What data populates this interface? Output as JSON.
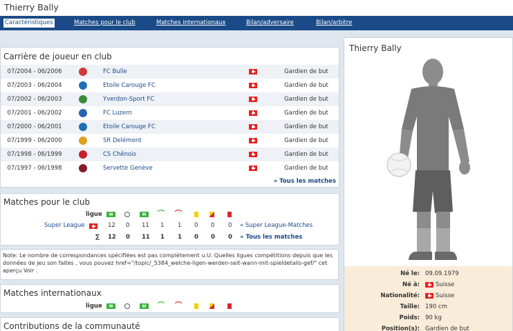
{
  "page": {
    "title": "Thierry Bally"
  },
  "nav": [
    {
      "label": "Caractéristiques",
      "active": true
    },
    {
      "label": "Matches pour le club"
    },
    {
      "label": "Matches internationaux"
    },
    {
      "label": "Bilan/adversaire"
    },
    {
      "label": "Bilan/arbitre"
    }
  ],
  "career": {
    "title": "Carrière de joueur en club",
    "rows": [
      {
        "period": "07/2004 - 06/2006",
        "club": "FC Bulle",
        "position": "Gardien de but",
        "logo_color": "#d23a3a"
      },
      {
        "period": "07/2003 - 06/2004",
        "club": "Etoile Carouge FC",
        "position": "Gardien de but",
        "logo_color": "#1f6fb5"
      },
      {
        "period": "07/2002 - 06/2003",
        "club": "Yverdon-Sport FC",
        "position": "Gardien de but",
        "logo_color": "#3a8a3a"
      },
      {
        "period": "07/2001 - 06/2002",
        "club": "FC Luzern",
        "position": "Gardien de but",
        "logo_color": "#2a62b3"
      },
      {
        "period": "07/2000 - 06/2001",
        "club": "Etoile Carouge FC",
        "position": "Gardien de but",
        "logo_color": "#1f6fb5"
      },
      {
        "period": "07/1999 - 06/2000",
        "club": "SR Delémont",
        "position": "Gardien de but",
        "logo_color": "#e0a020"
      },
      {
        "period": "07/1998 - 06/1999",
        "club": "CS Chênois",
        "position": "Gardien de but",
        "logo_color": "#c8202a"
      },
      {
        "period": "07/1997 - 06/1998",
        "club": "Servette Genève",
        "position": "Gardien de but",
        "logo_color": "#8a1a2a"
      }
    ],
    "all_matches_link": "» Tous les matches"
  },
  "club_matches": {
    "title": "Matches pour le club",
    "col_label": "ligue",
    "league_row": {
      "league": "Super League",
      "values": [
        "12",
        "0",
        "11",
        "1",
        "1",
        "0",
        "0",
        "0"
      ],
      "link": "» Super League-Matches"
    },
    "total_row": {
      "symbol": "∑",
      "values": [
        "12",
        "0",
        "11",
        "1",
        "1",
        "0",
        "0",
        "0"
      ],
      "link": "» Tous les matches"
    }
  },
  "note": "Note: Le nombre de correspondances spécifiées est pas complètement u.U. Quelles ligues compétitions depuis que les données de jeu son faites , vous pouvez href=\"/topic/_5384_welche-ligen-werden-seit-wann-mit-spieldetails-gef/\" cet aperçu Voir .",
  "international": {
    "title": "Matches internationaux",
    "col_label": "ligue"
  },
  "community": {
    "title": "Contributions de la communauté"
  },
  "profile": {
    "name": "Thierry Bally",
    "info": [
      {
        "label": "Né le:",
        "value": "09.09.1979"
      },
      {
        "label": "Né à:",
        "value": "Suisse",
        "flag": true
      },
      {
        "label": "Nationalité:",
        "value": "Suisse",
        "flag": true
      },
      {
        "label": "Taille:",
        "value": "190 cm"
      },
      {
        "label": "Poids:",
        "value": "90 kg"
      },
      {
        "label": "Position(s):",
        "value": "Gardien de but"
      }
    ]
  },
  "colors": {
    "brand": "#1a4b88",
    "info_bg": "#f9ecd9",
    "goal_green": "#3fb13f"
  }
}
